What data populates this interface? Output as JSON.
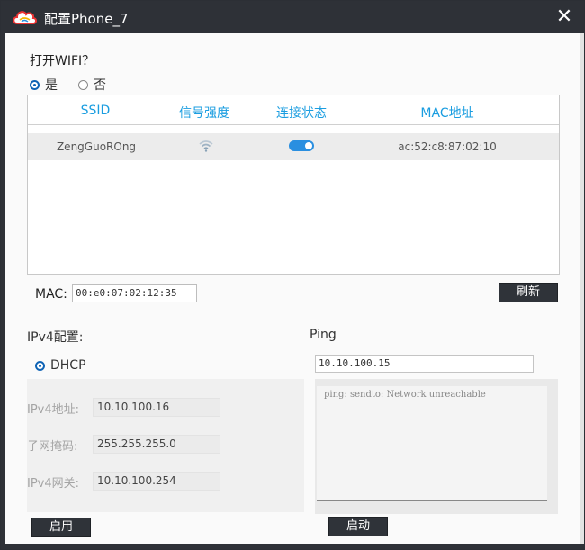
{
  "window": {
    "title": "配置Phone_7",
    "close_icon": "✕"
  },
  "wifi": {
    "question": "打开WIFI？",
    "options": [
      "是",
      "否"
    ],
    "selected": 0,
    "columns": [
      "SSID",
      "信号强度",
      "连接状态",
      "MAC地址"
    ],
    "rows": [
      {
        "ssid": "ZengGuoROng",
        "signal_icon": "wifi-icon",
        "connected": true,
        "mac": "ac:52:c8:87:02:10"
      }
    ],
    "accent": "#1a9de0"
  },
  "mac": {
    "label": "MAC:",
    "value": "00:e0:07:02:12:35",
    "refresh_label": "刷新"
  },
  "ipv4": {
    "section_label": "IPv4配置:",
    "dhcp_label": "DHCP",
    "address_label": "IPv4地址:",
    "address_value": "10.10.100.16",
    "subnet_label": "子网掩码:",
    "subnet_value": "255.255.255.0",
    "gateway_label": "IPv4网关:",
    "gateway_value": "10.10.100.254",
    "apply_label": "启用"
  },
  "ping": {
    "section_label": "Ping",
    "target": "10.10.100.15",
    "output": "ping: sendto: Network unreachable",
    "start_label": "启动"
  },
  "colors": {
    "titlebar": "#2e3137",
    "radio_checked": "#0e63b5",
    "toggle_on": "#2a8fe0"
  }
}
